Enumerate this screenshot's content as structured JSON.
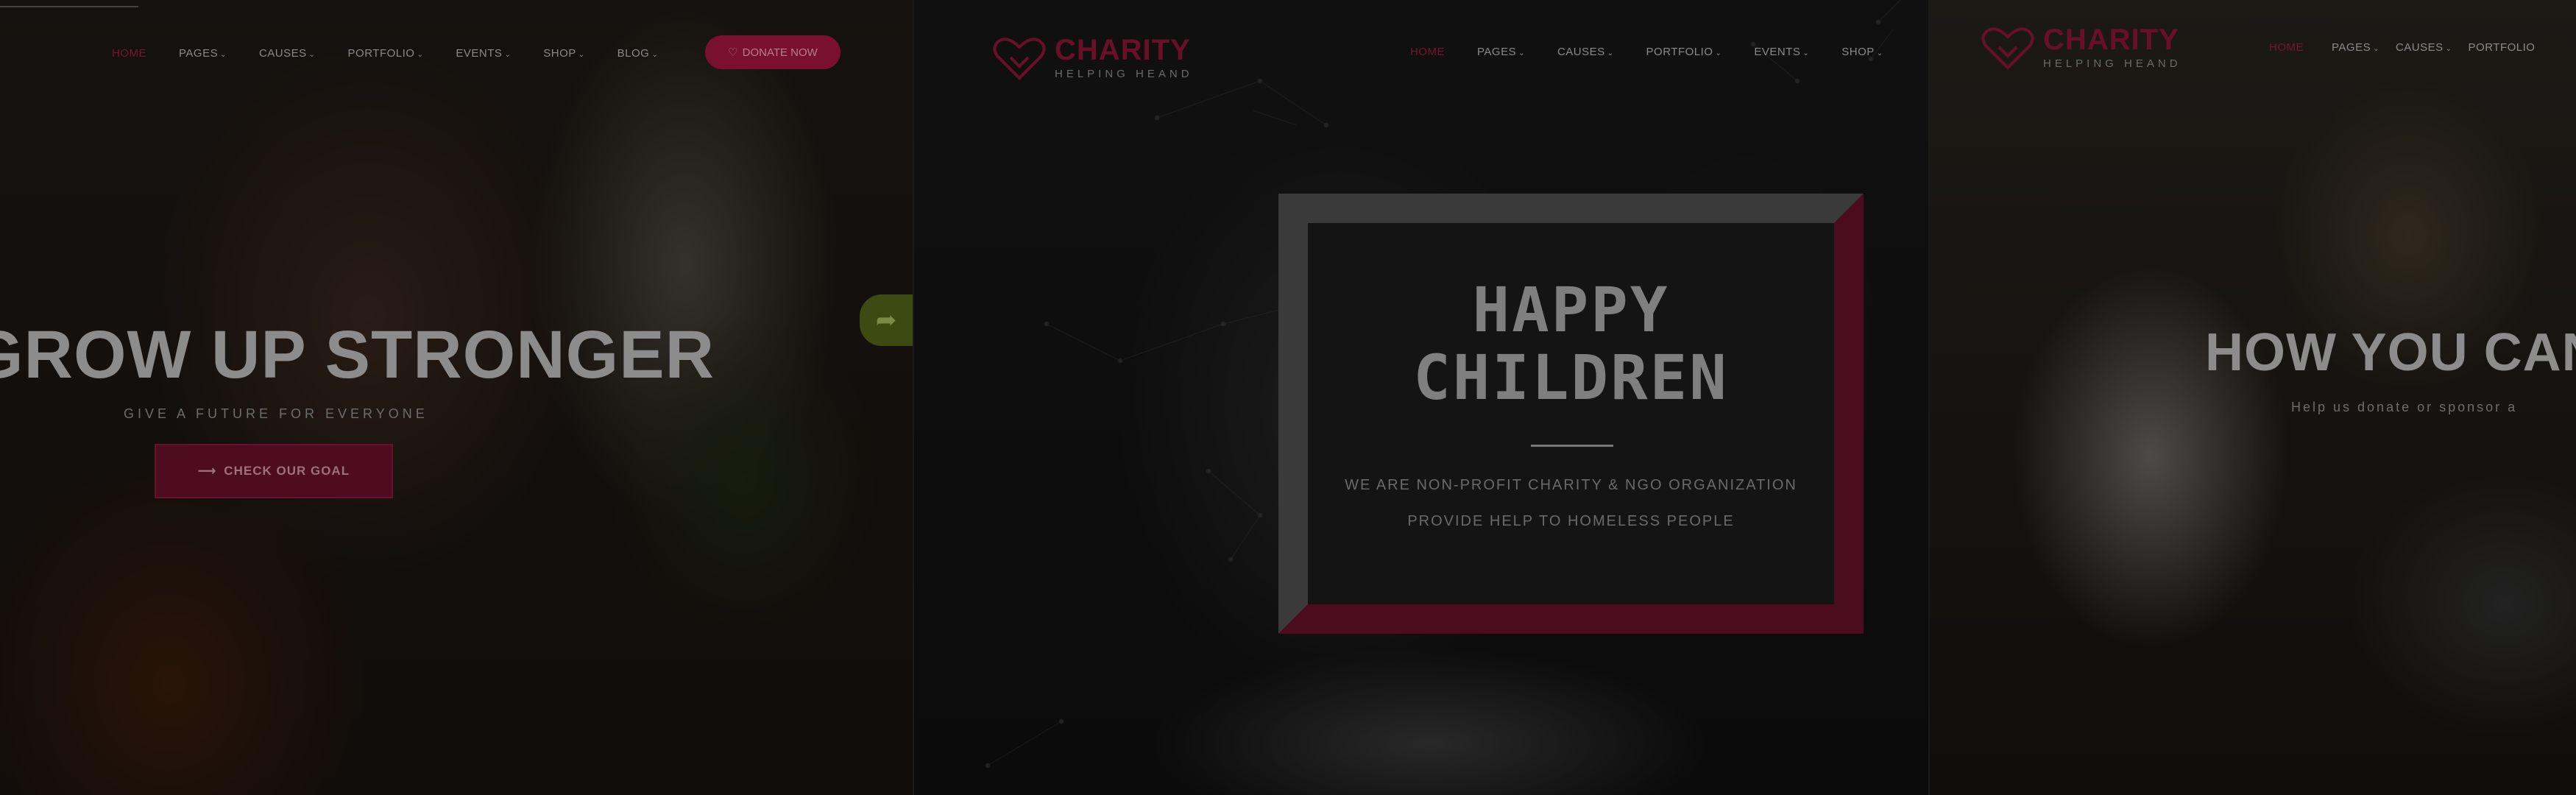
{
  "slide1": {
    "nav": [
      "Home",
      "Pages",
      "Causes",
      "Portfolio",
      "Events",
      "Shop",
      "Blog"
    ],
    "donate_label": "DONATE NOW",
    "headline": "GROW UP STRONGER",
    "subline": "GIVE A FUTURE FOR EVERYONE",
    "cta_label": "CHECK OUR GOAL"
  },
  "slide2": {
    "logo_name": "CHARITY",
    "logo_tag": "HELPING HEAND",
    "nav": [
      "Home",
      "Pages",
      "Causes",
      "Portfolio",
      "Events",
      "Shop"
    ],
    "title_line1": "HAPPY",
    "title_line2": "CHILDREN",
    "text_line1": "WE ARE NON-PROFIT CHARITY & NGO ORGANIZATION",
    "text_line2": "PROVIDE HELP TO HOMELESS PEOPLE"
  },
  "slide3": {
    "logo_name": "CHARITY",
    "logo_tag": "HELPING HEAND",
    "nav": [
      "Home",
      "Pages",
      "Causes",
      "Portfolio"
    ],
    "headline": "HOW YOU CAN",
    "subline": "Help us donate or sponsor a"
  },
  "colors": {
    "brand": "#7a1030",
    "overlay": "rgba(0,0,0,0.62)",
    "muted_text": "#8a8a8a"
  },
  "icons": {
    "donate": "heart-icon",
    "cta": "arrow-right-icon",
    "share": "share-arrow-icon",
    "nav_dropdown": "chevron-down-icon"
  }
}
